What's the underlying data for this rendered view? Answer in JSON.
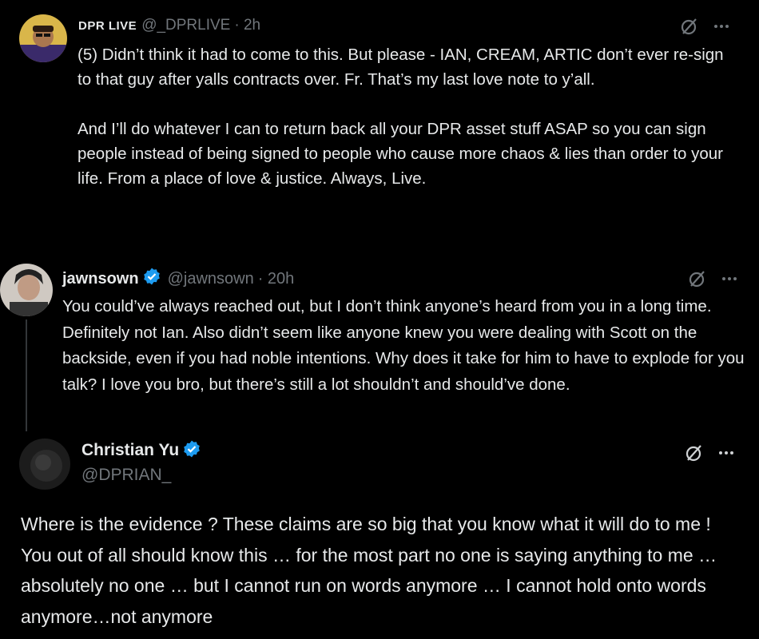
{
  "tweets": [
    {
      "name": "DPR LIVE",
      "handle": "@_DPRLIVE",
      "time": "· 2h",
      "paragraphs": [
        "(5) Didn’t think it had to come to this. But please -  IAN, CREAM, ARTIC don’t ever re-sign to that guy after yalls contracts over. Fr. That’s my last love note to y’all.",
        "And I’ll do whatever I can to return back all your DPR asset stuff ASAP so you can sign people instead of being signed to people who cause more chaos & lies than order to your life. From a place of love & justice. Always, Live."
      ]
    },
    {
      "name": "jawnsown",
      "handle": "@jawnsown",
      "time": "· 20h",
      "paragraphs": [
        "You could’ve always reached out, but I don’t think anyone’s heard from you in a long time. Definitely not Ian. Also didn’t seem like anyone knew you were dealing with Scott on the backside, even if you had noble intentions. Why does it take for him to have to explode for you talk? I love you bro, but there’s still a lot shouldn’t and should’ve done."
      ]
    },
    {
      "name": "Christian Yu",
      "handle": "@DPRIAN_",
      "paragraphs": [
        "Where is the evidence ? These claims are so big that you know what it will do to me ! You out of all should know this … for the most part no one is saying anything to me … absolutely no one … but I cannot run on words anymore … I cannot hold onto words anymore…not anymore"
      ]
    }
  ],
  "icons": {
    "grok": "grok-slash-circle-icon",
    "more": "more-dots-icon",
    "verified": "verified-badge-icon"
  },
  "colors": {
    "background": "#000000",
    "text": "#e7e9ea",
    "muted": "#71767b",
    "verified": "#1d9bf0"
  }
}
